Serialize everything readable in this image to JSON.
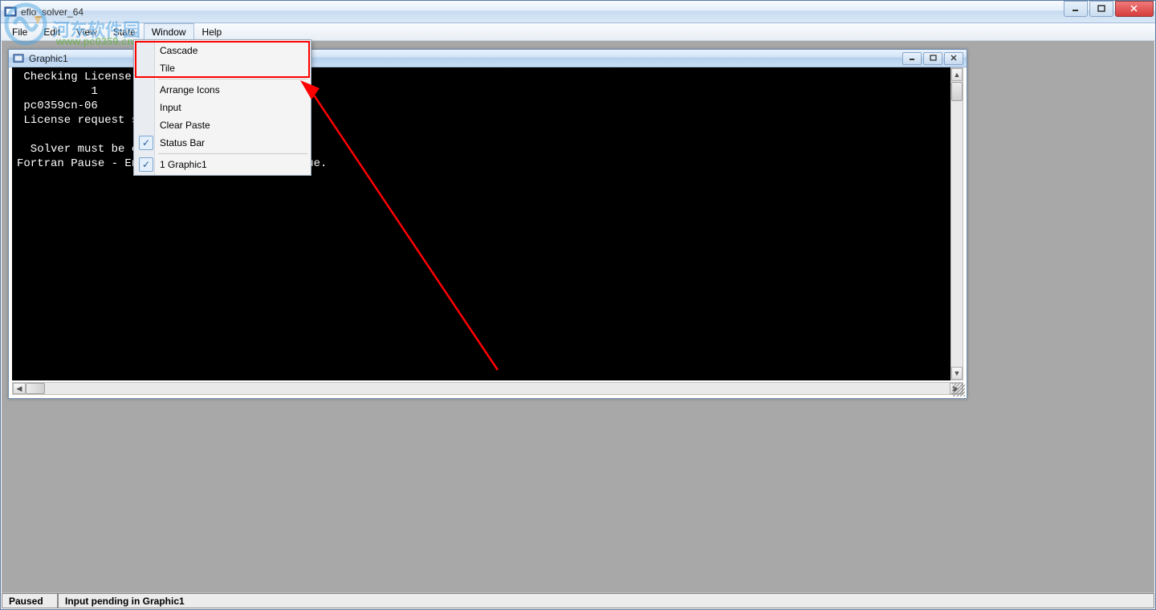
{
  "app": {
    "title": "eflo_solver_64"
  },
  "menubar": {
    "items": [
      "File",
      "Edit",
      "View",
      "State",
      "Window",
      "Help"
    ],
    "active_index": 4
  },
  "dropdown": {
    "items": [
      {
        "label": "Cascade",
        "checked": false
      },
      {
        "label": "Tile",
        "checked": false
      },
      {
        "sep": true
      },
      {
        "label": "Arrange Icons",
        "checked": false
      },
      {
        "label": "Input",
        "checked": false
      },
      {
        "label": "Clear Paste",
        "checked": false
      },
      {
        "label": "Status Bar",
        "checked": true
      },
      {
        "sep": true
      },
      {
        "label": "1 Graphic1",
        "checked": true
      }
    ]
  },
  "child": {
    "title": "Graphic1",
    "console_lines": [
      " Checking License",
      "           1",
      " pc0359cn-06",
      " License request s",
      "",
      "  Solver must be ex                   o GUI",
      "Fortran Pause - En                    ontinue."
    ]
  },
  "status": {
    "left": "Paused",
    "right": "Input pending in Graphic1"
  },
  "watermark": {
    "text1": "河东软件园",
    "text2": "www.pc0359.cn"
  }
}
